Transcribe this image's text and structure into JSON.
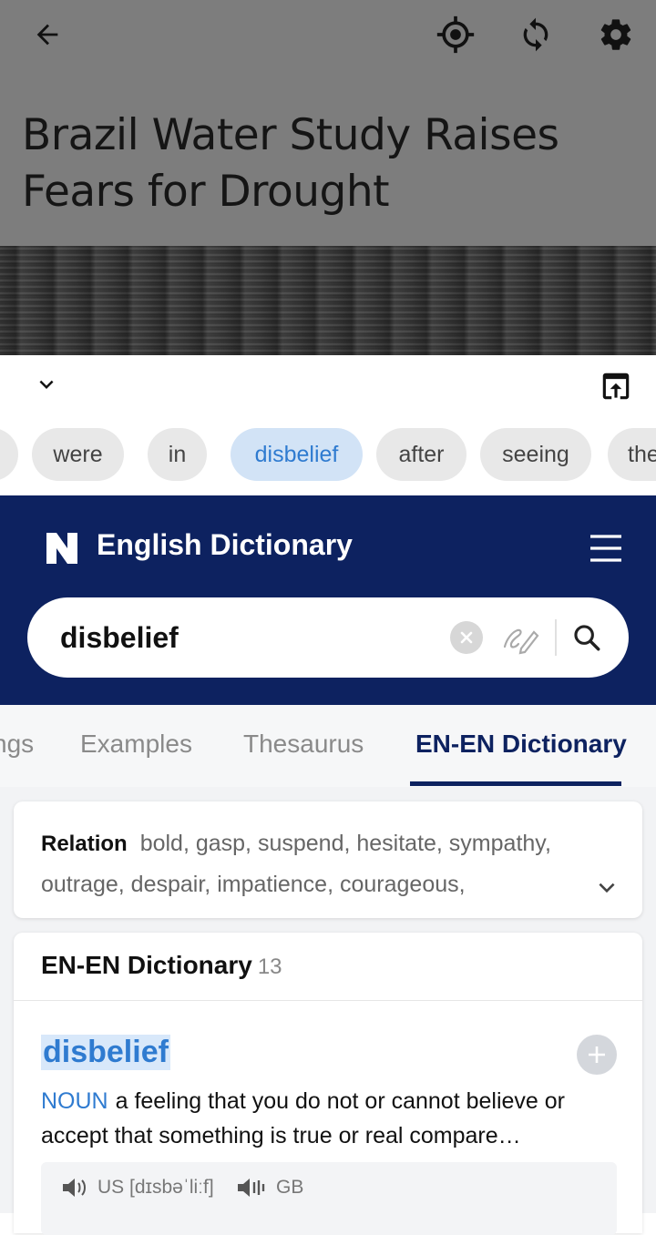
{
  "article": {
    "title": "Brazil Water Study Raises Fears for Drought"
  },
  "top_bar": {
    "icons": [
      "back-arrow-icon",
      "target-icon",
      "sync-icon",
      "settings-gear-icon"
    ]
  },
  "sheet": {
    "icons": [
      "chevron-down-icon",
      "open-in-app-icon"
    ],
    "chips": [
      {
        "label": ""
      },
      {
        "label": "were"
      },
      {
        "label": "in"
      },
      {
        "label": "disbelief",
        "active": true
      },
      {
        "label": "after"
      },
      {
        "label": "seeing"
      },
      {
        "label": "the"
      }
    ]
  },
  "dictionary": {
    "logo": "N",
    "title": "English Dictionary",
    "search_value": "disbelief",
    "tabs": [
      {
        "label": "ngs"
      },
      {
        "label": "Examples"
      },
      {
        "label": "Thesaurus"
      },
      {
        "label": "EN-EN Dictionary",
        "active": true
      }
    ],
    "relation": {
      "label": "Relation",
      "words": "bold,  gasp,  suspend,  hesitate,  sympathy,  outrage,  despair,  impatience,  courageous,"
    },
    "entry_section": {
      "title": "EN-EN Dictionary",
      "count": "13"
    },
    "entry": {
      "headword": "disbelief",
      "pos": "NOUN",
      "definition": "a feeling that you do not or cannot believe or accept that something is true or real compare…",
      "pron_us": "US [dɪsbəˈliːf]",
      "pron_gb": "GB"
    }
  },
  "colors": {
    "header_bg": "#0d2260",
    "accent_blue": "#2f7bd0",
    "chip_active_bg": "#d2e3f6",
    "chip_bg": "#e8e8e8",
    "dim_overlay": "#7d7d7d"
  }
}
